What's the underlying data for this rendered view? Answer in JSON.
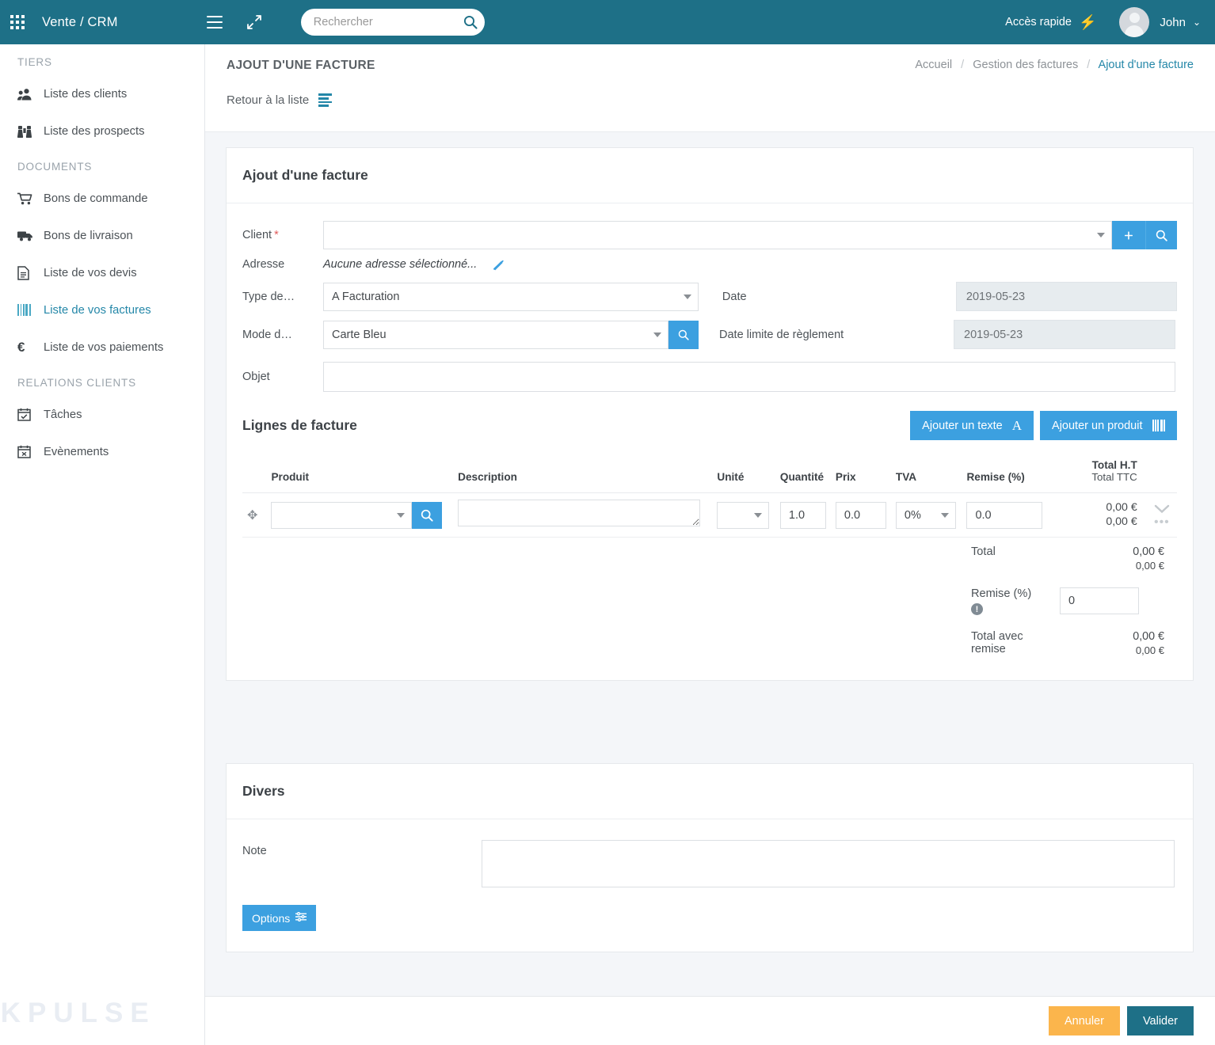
{
  "topbar": {
    "brand": "Vente / CRM",
    "search_placeholder": "Rechercher",
    "search_value": "",
    "quick_access": "Accès rapide",
    "username": "John"
  },
  "sidebar": {
    "groups": [
      {
        "title": "TIERS",
        "items": [
          {
            "label": "Liste des clients",
            "icon": "users-icon",
            "active": false
          },
          {
            "label": "Liste des prospects",
            "icon": "binoculars-icon",
            "active": false
          }
        ]
      },
      {
        "title": "DOCUMENTS",
        "items": [
          {
            "label": "Bons de commande",
            "icon": "cart-icon",
            "active": false
          },
          {
            "label": "Bons de livraison",
            "icon": "truck-icon",
            "active": false
          },
          {
            "label": "Liste de vos devis",
            "icon": "document-icon",
            "active": false
          },
          {
            "label": "Liste de vos factures",
            "icon": "barcode-icon",
            "active": true
          },
          {
            "label": "Liste de vos paiements",
            "icon": "euro-icon",
            "active": false
          }
        ]
      },
      {
        "title": "RELATIONS CLIENTS",
        "items": [
          {
            "label": "Tâches",
            "icon": "calendar-check-icon",
            "active": false
          },
          {
            "label": "Evènements",
            "icon": "calendar-x-icon",
            "active": false
          }
        ]
      }
    ],
    "watermark": ".KPULSE"
  },
  "page": {
    "title": "AJOUT D'UNE FACTURE",
    "breadcrumb": [
      "Accueil",
      "Gestion des factures",
      "Ajout d'une facture"
    ],
    "back_link": "Retour à la liste"
  },
  "form": {
    "card_title": "Ajout d'une facture",
    "client_label": "Client",
    "client_required_mark": "*",
    "client_value": "",
    "adresse_label": "Adresse",
    "adresse_value": "Aucune adresse sélectionné...",
    "type_label": "Type de…",
    "type_value": "A Facturation",
    "date_label": "Date",
    "date_value": "2019-05-23",
    "mode_label": "Mode d…",
    "mode_value": "Carte Bleu",
    "date_limite_label": "Date limite de règlement",
    "date_limite_value": "2019-05-23",
    "objet_label": "Objet",
    "objet_value": ""
  },
  "lines": {
    "title": "Lignes de facture",
    "add_text_btn": "Ajouter un texte",
    "add_product_btn": "Ajouter un produit",
    "headers": {
      "produit": "Produit",
      "description": "Description",
      "unite": "Unité",
      "quantite": "Quantité",
      "prix": "Prix",
      "tva": "TVA",
      "remise": "Remise (%)",
      "total_ht": "Total H.T",
      "total_ttc": "Total TTC"
    },
    "rows": [
      {
        "produit": "",
        "description": "",
        "unite": "",
        "quantite": "1.0",
        "prix": "0.0",
        "tva": "0%",
        "remise": "0.0",
        "total_ht": "0,00 €",
        "total_ttc": "0,00 €"
      }
    ],
    "totals": {
      "total_label": "Total",
      "total_ht": "0,00 €",
      "total_ttc": "0,00 €",
      "remise_label": "Remise (%)",
      "remise_value": "0",
      "total_remise_label": "Total avec remise",
      "total_remise_ht": "0,00 €",
      "total_remise_ttc": "0,00 €"
    }
  },
  "divers": {
    "title": "Divers",
    "note_label": "Note",
    "note_value": "",
    "options_btn": "Options"
  },
  "footer": {
    "cancel": "Annuler",
    "validate": "Valider"
  },
  "colors": {
    "header_teal": "#1e7087",
    "accent_blue": "#3ca0e0",
    "link_blue": "#2487a8",
    "cancel_orange": "#fbb54c",
    "required_red": "#e05c5c"
  }
}
